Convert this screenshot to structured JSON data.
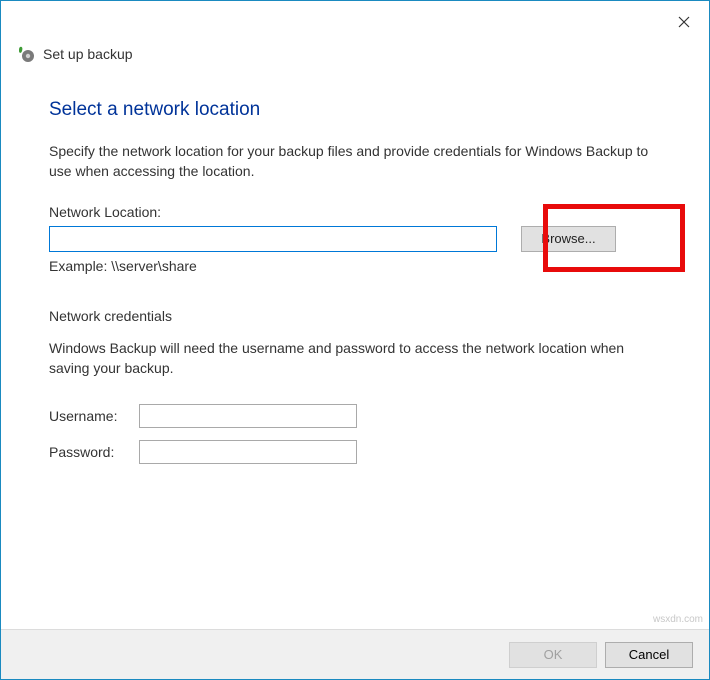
{
  "window": {
    "title": "Set up backup"
  },
  "main": {
    "heading": "Select a network location",
    "description": "Specify the network location for your backup files and provide credentials for Windows Backup to use when accessing the location.",
    "location_label": "Network Location:",
    "location_value": "",
    "browse_label": "Browse...",
    "example_text": "Example: \\\\server\\share",
    "credentials_title": "Network credentials",
    "credentials_desc": "Windows Backup will need the username and password to access the network location when saving your backup.",
    "username_label": "Username:",
    "username_value": "",
    "password_label": "Password:",
    "password_value": ""
  },
  "footer": {
    "ok_label": "OK",
    "cancel_label": "Cancel"
  },
  "watermark": "wsxdn.com"
}
